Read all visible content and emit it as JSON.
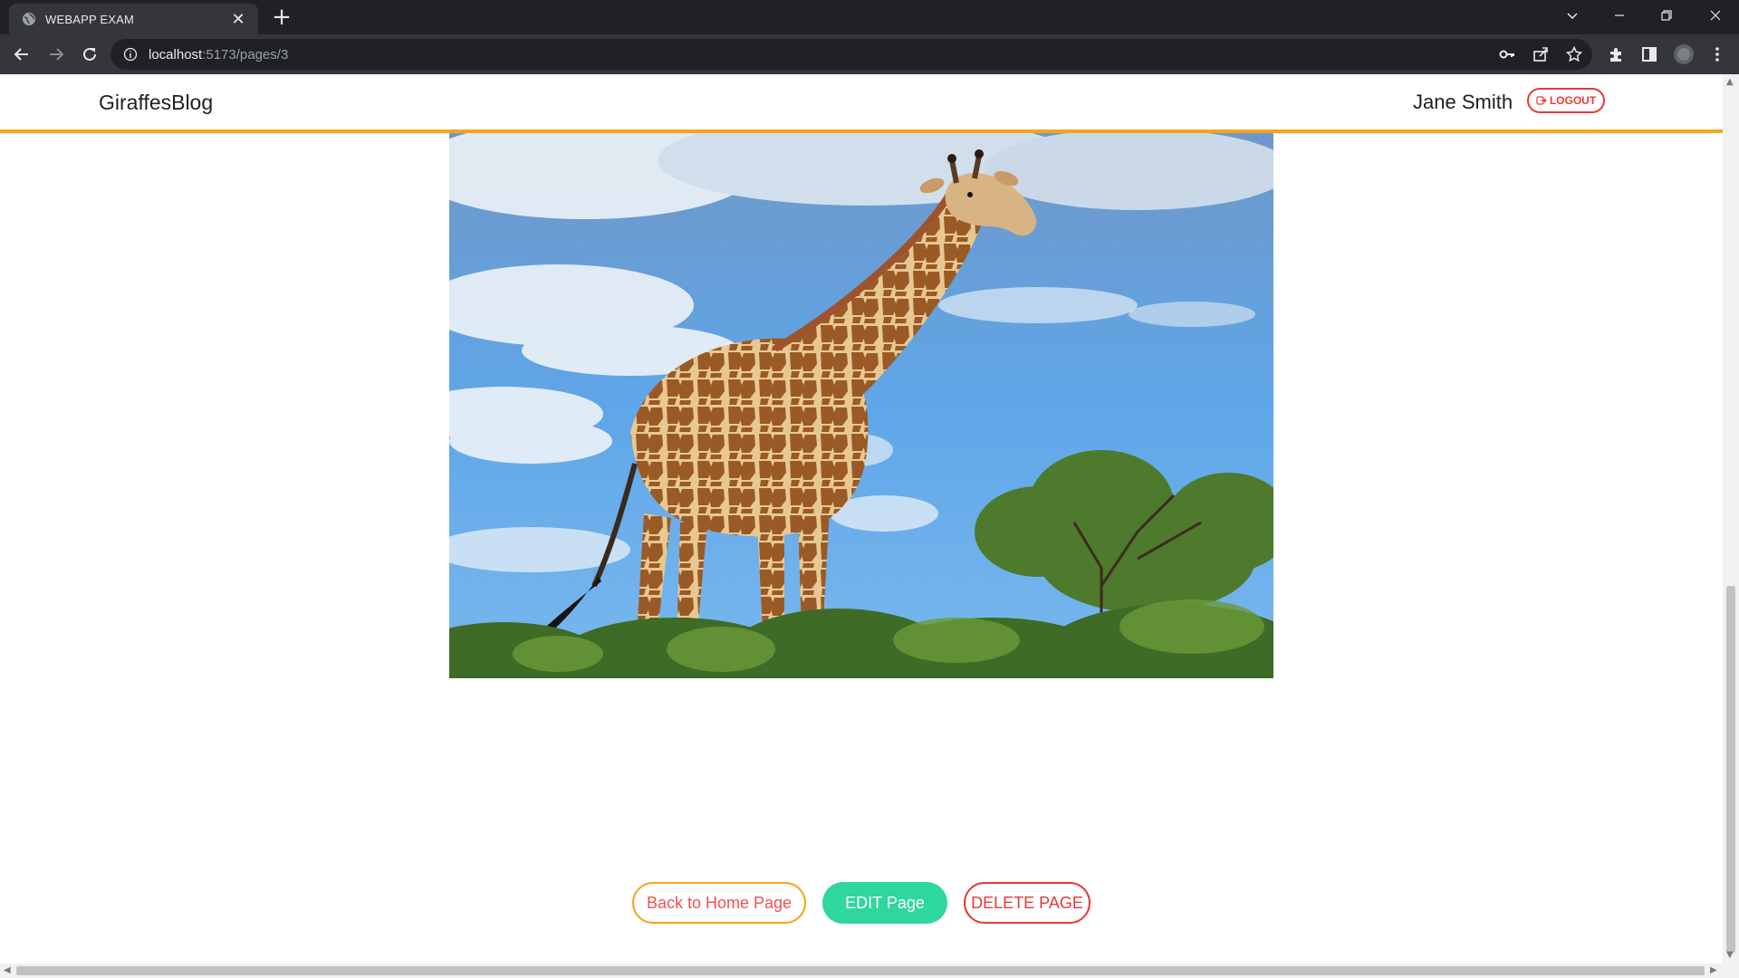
{
  "browser": {
    "tab_title": "WEBAPP EXAM",
    "url_host": "localhost",
    "url_path": ":5173/pages/3",
    "icons": [
      "globe-icon",
      "close-icon",
      "plus-icon",
      "chevron-down-icon",
      "minimize-icon",
      "restore-icon",
      "close-window-icon",
      "back-icon",
      "forward-icon",
      "reload-icon",
      "info-icon",
      "key-icon",
      "share-icon",
      "star-icon",
      "extensions-icon",
      "side-panel-icon",
      "profile-icon",
      "kebab-menu-icon"
    ]
  },
  "header": {
    "brand": "GiraffesBlog",
    "user_name": "Jane Smith",
    "logout_label": "LOGOUT",
    "accent_color": "#f4a51c"
  },
  "main": {
    "image_subject": "giraffe"
  },
  "actions": {
    "back_label": "Back to Home Page",
    "edit_label": "EDIT Page",
    "delete_label": "DELETE PAGE",
    "colors": {
      "back_border": "#f4a51c",
      "edit_bg": "#2ed6a0",
      "delete": "#e53935"
    }
  }
}
